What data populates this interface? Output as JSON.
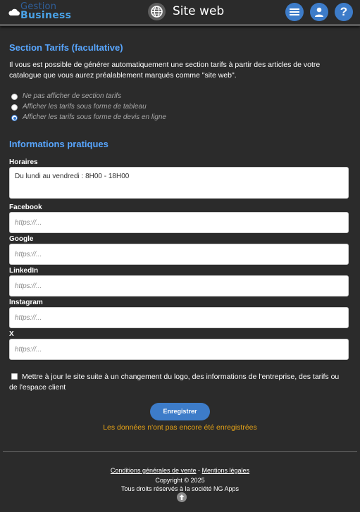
{
  "header": {
    "logo_top": "Gestion",
    "logo_bottom": "Business",
    "title": "Site web",
    "help_label": "?"
  },
  "tarifs": {
    "title": "Section Tarifs (facultative)",
    "description": "Il vous est possible de générer automatiquement une section tarifs à partir des articles de votre catalogue que vous aurez préalablement marqués comme \"site web\".",
    "options": [
      {
        "label": "Ne pas afficher de section tarifs",
        "selected": false
      },
      {
        "label": "Afficher les tarifs sous forme de tableau",
        "selected": false
      },
      {
        "label": "Afficher les tarifs sous forme de devis en ligne",
        "selected": true
      }
    ]
  },
  "info": {
    "title": "Informations pratiques",
    "horaires": {
      "label": "Horaires",
      "value": "Du lundi au vendredi : 8H00 - 18H00"
    },
    "facebook": {
      "label": "Facebook",
      "placeholder": "https://..."
    },
    "google": {
      "label": "Google",
      "placeholder": "https://..."
    },
    "linkedin": {
      "label": "LinkedIn",
      "placeholder": "https://..."
    },
    "instagram": {
      "label": "Instagram",
      "placeholder": "https://..."
    },
    "x": {
      "label": "X",
      "placeholder": "https://..."
    }
  },
  "update_checkbox": {
    "label": "Mettre à jour le site suite à un changement du logo, des informations de l'entreprise, des tarifs ou de l'espace client",
    "checked": false
  },
  "save_button": "Enregistrer",
  "unsaved_warning": "Les données n'ont pas encore été enregistrées",
  "footer": {
    "cgv": "Conditions générales de vente",
    "separator": " - ",
    "legal": "Mentions légales",
    "copyright": "Copyright © 2025",
    "rights": "Tous droits réservés à la société NG Apps"
  },
  "colors": {
    "accent": "#3d7cc9",
    "heading": "#58a6ff",
    "warning": "#e6a317",
    "background": "#2b2b2b"
  },
  "icons": [
    "cloud-icon",
    "globe-icon",
    "menu-icon",
    "user-icon",
    "help-icon",
    "arrow-up-icon"
  ]
}
